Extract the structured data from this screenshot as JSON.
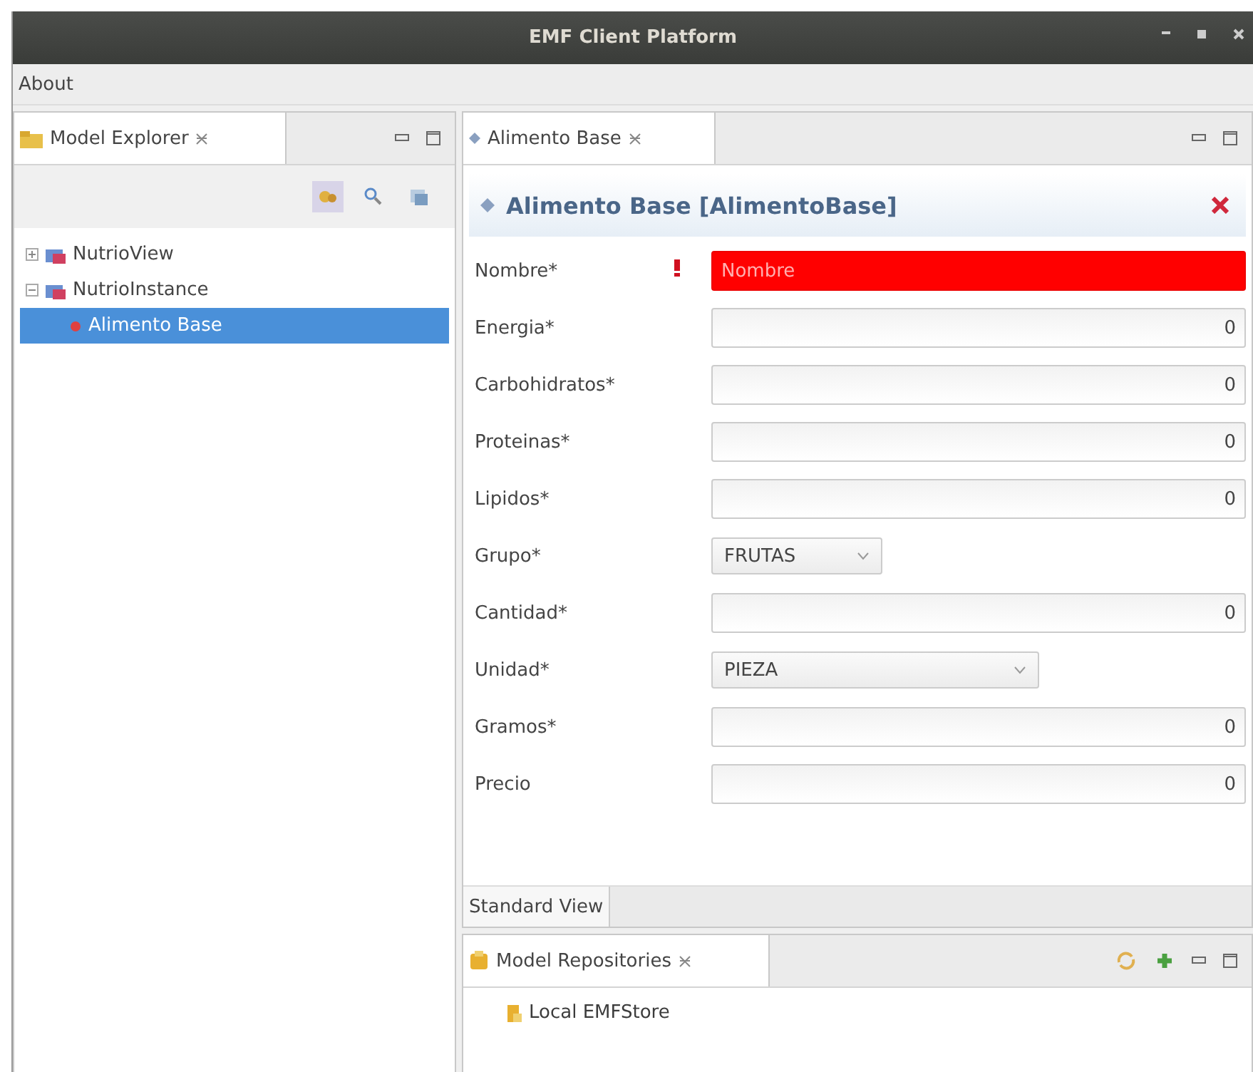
{
  "window": {
    "title": "EMF Client Platform"
  },
  "menu": [
    "About"
  ],
  "explorer": {
    "tab": "Model Explorer",
    "tree": [
      {
        "label": "NutrioView",
        "expanded": false,
        "selected": false
      },
      {
        "label": "NutrioInstance",
        "expanded": true,
        "selected": false,
        "children": [
          {
            "label": "Alimento Base",
            "selected": true
          }
        ]
      }
    ]
  },
  "editor": {
    "tab": "Alimento Base",
    "heading": "Alimento Base [AlimentoBase]",
    "fields": [
      {
        "label": "Nombre*",
        "kind": "text",
        "placeholder": "Nombre",
        "error": true
      },
      {
        "label": "Energia*",
        "kind": "number",
        "value": "0",
        "error": false
      },
      {
        "label": "Carbohidratos*",
        "kind": "number",
        "value": "0",
        "error": false
      },
      {
        "label": "Proteinas*",
        "kind": "number",
        "value": "0",
        "error": false
      },
      {
        "label": "Lipidos*",
        "kind": "number",
        "value": "0",
        "error": false
      },
      {
        "label": "Grupo*",
        "kind": "select",
        "value": "FRUTAS"
      },
      {
        "label": "Cantidad*",
        "kind": "number",
        "value": "0",
        "error": false
      },
      {
        "label": "Unidad*",
        "kind": "select-wide",
        "value": "PIEZA"
      },
      {
        "label": "Gramos*",
        "kind": "number",
        "value": "0",
        "error": false
      },
      {
        "label": "Precio",
        "kind": "number",
        "value": "0",
        "error": false
      }
    ],
    "view_tab": "Standard View"
  },
  "repositories": {
    "tab": "Model Repositories",
    "items": [
      "Local EMFStore"
    ]
  }
}
